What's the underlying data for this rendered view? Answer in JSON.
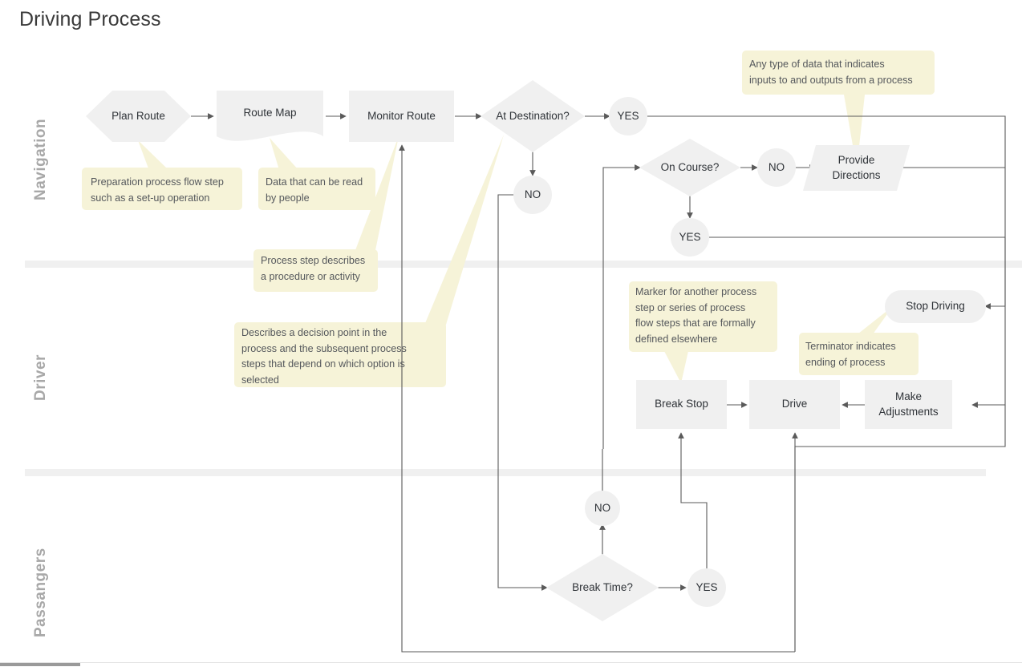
{
  "title": "Driving Process",
  "colors": {
    "shape_fill": "#f0f0f0",
    "callout_fill": "#f6f3d8",
    "lane_divider": "#f0f0f0",
    "connector": "#5a5a5a",
    "lane_label": "#a8a8a8",
    "shape_text": "#2f3338",
    "callout_text": "#55585c",
    "title_text": "#3a3a3a"
  },
  "lanes": [
    {
      "id": "navigation",
      "label": "Navigation"
    },
    {
      "id": "driver",
      "label": "Driver"
    },
    {
      "id": "passangers",
      "label": "Passangers"
    }
  ],
  "nodes": {
    "plan_route": {
      "label": "Plan Route",
      "shape": "hexagon-preparation"
    },
    "route_map": {
      "label": "Route Map",
      "shape": "document"
    },
    "monitor_route": {
      "label": "Monitor Route",
      "shape": "process-rectangle"
    },
    "at_destination": {
      "label": "At Destination?",
      "shape": "decision-diamond"
    },
    "yes_destination": {
      "label": "YES",
      "shape": "connector-circle"
    },
    "no_destination": {
      "label": "NO",
      "shape": "connector-circle"
    },
    "on_course": {
      "label": "On Course?",
      "shape": "decision-diamond"
    },
    "no_course": {
      "label": "NO",
      "shape": "connector-circle"
    },
    "yes_course": {
      "label": "YES",
      "shape": "connector-circle"
    },
    "provide_directions": {
      "label": "Provide Directions",
      "label_lines": [
        "Provide",
        "Directions"
      ],
      "shape": "parallelogram-data"
    },
    "stop_driving": {
      "label": "Stop Driving",
      "shape": "terminator-rounded"
    },
    "break_stop": {
      "label": "Break Stop",
      "shape": "process-rectangle"
    },
    "drive": {
      "label": "Drive",
      "shape": "process-rectangle"
    },
    "make_adjustments": {
      "label": "Make Adjustments",
      "label_lines": [
        "Make",
        "Adjustments"
      ],
      "shape": "process-rectangle"
    },
    "break_time": {
      "label": "Break Time?",
      "shape": "decision-diamond"
    },
    "no_break": {
      "label": "NO",
      "shape": "connector-circle"
    },
    "yes_break": {
      "label": "YES",
      "shape": "connector-circle"
    }
  },
  "callouts": {
    "preparation": {
      "lines": [
        "Preparation process flow step",
        "such as a set-up operation"
      ],
      "points_to": "plan_route"
    },
    "document": {
      "lines": [
        "Data that can be read",
        "by people"
      ],
      "points_to": "route_map"
    },
    "process": {
      "lines": [
        "Process step describes",
        "a procedure or activity"
      ],
      "points_to": "monitor_route"
    },
    "decision": {
      "lines": [
        "Describes a decision point in the",
        "process and the subsequent process",
        "steps that depend on which option is",
        "selected"
      ],
      "points_to": "at_destination"
    },
    "data": {
      "lines": [
        "Any type of data that indicates",
        "inputs to and outputs from a process"
      ],
      "points_to": "provide_directions"
    },
    "predefined": {
      "lines": [
        "Marker for another process",
        "step or series of process",
        "flow steps that are formally",
        "defined elsewhere"
      ],
      "points_to": "break_stop"
    },
    "terminator": {
      "lines": [
        "Terminator indicates",
        "ending of process"
      ],
      "points_to": "stop_driving"
    }
  }
}
